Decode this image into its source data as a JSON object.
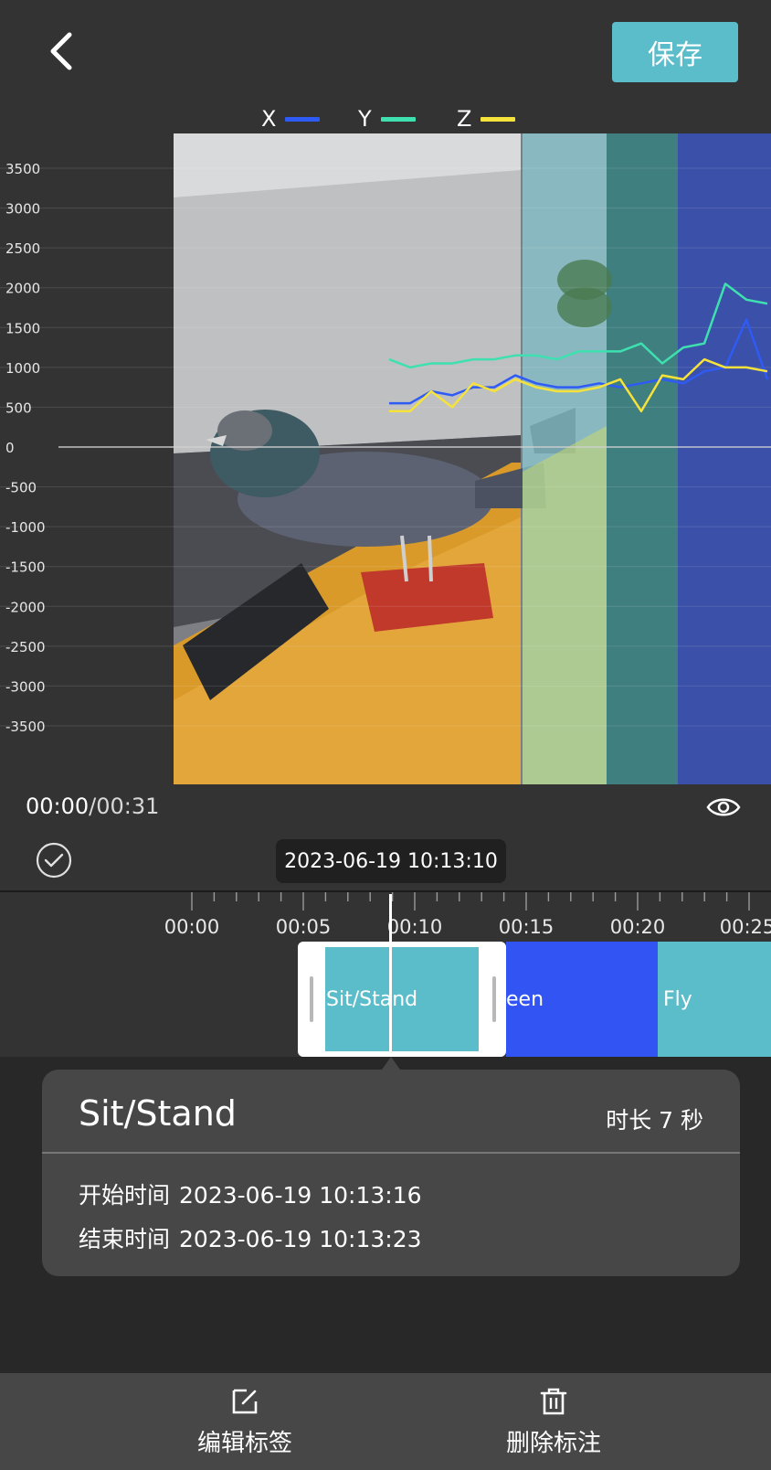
{
  "header": {
    "back_icon": "chevron-left-icon",
    "save_label": "保存"
  },
  "legend": [
    {
      "label": "X",
      "color": "#2f5bf5"
    },
    {
      "label": "Y",
      "color": "#3fe0b0"
    },
    {
      "label": "Z",
      "color": "#f5e23a"
    }
  ],
  "chart_data": {
    "type": "line",
    "y_ticks": [
      3500,
      3000,
      2500,
      2000,
      1500,
      1000,
      500,
      0,
      -500,
      -1000,
      -1500,
      -2000,
      -2500,
      -3000,
      -3500
    ],
    "ylim": [
      -3500,
      3500
    ],
    "band_colors": [
      "#8fd3dd",
      "#3a7f80",
      "#3b50a8"
    ],
    "series": [
      {
        "name": "X",
        "color": "#2f5bf5",
        "values": [
          550,
          550,
          700,
          650,
          750,
          750,
          900,
          800,
          750,
          750,
          800,
          750,
          800,
          850,
          800,
          950,
          1000,
          1600,
          850
        ]
      },
      {
        "name": "Y",
        "color": "#3fe0b0",
        "values": [
          1100,
          1000,
          1050,
          1050,
          1100,
          1100,
          1150,
          1150,
          1100,
          1200,
          1200,
          1200,
          1300,
          1050,
          1250,
          1300,
          2050,
          1850,
          1800
        ]
      },
      {
        "name": "Z",
        "color": "#f5e23a",
        "values": [
          450,
          450,
          700,
          500,
          800,
          700,
          850,
          750,
          700,
          700,
          750,
          850,
          450,
          900,
          850,
          1100,
          1000,
          1000,
          950
        ]
      }
    ]
  },
  "player": {
    "current_time": "00:00",
    "total_time": "/00:31",
    "timestamp": "2023-06-19 10:13:10"
  },
  "timeline": {
    "ticks": [
      "00:00",
      "00:05",
      "00:10",
      "00:15",
      "00:20",
      "00:25"
    ],
    "segments": [
      {
        "label": "Sit/Stand"
      },
      {
        "label": "een"
      },
      {
        "label": "Fly"
      }
    ]
  },
  "card": {
    "title": "Sit/Stand",
    "duration": "时长 7 秒",
    "start_label": "开始时间",
    "start_value": "2023-06-19 10:13:16",
    "end_label": "结束时间",
    "end_value": "2023-06-19 10:13:23"
  },
  "toolbar": {
    "edit_label": "编辑标签",
    "delete_label": "删除标注"
  }
}
